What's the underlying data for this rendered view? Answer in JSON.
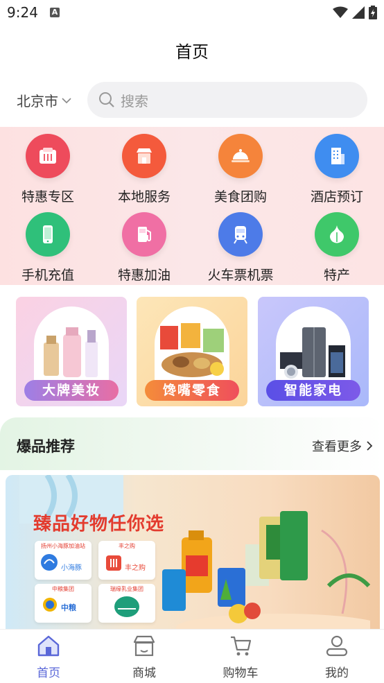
{
  "status_bar": {
    "time": "9:24",
    "notification_badge": "A"
  },
  "header": {
    "title": "首页"
  },
  "location": {
    "city": "北京市"
  },
  "search": {
    "placeholder": "搜索"
  },
  "categories": [
    {
      "label": "特惠专区",
      "icon": "ticket-icon",
      "color": "#ee4b5c"
    },
    {
      "label": "本地服务",
      "icon": "shop-icon",
      "color": "#f45a3c"
    },
    {
      "label": "美食团购",
      "icon": "dish-cover-icon",
      "color": "#f5843b"
    },
    {
      "label": "酒店预订",
      "icon": "building-icon",
      "color": "#3f8df0"
    },
    {
      "label": "手机充值",
      "icon": "phone-icon",
      "color": "#2fc07a"
    },
    {
      "label": "特惠加油",
      "icon": "fuel-icon",
      "color": "#f06fa4"
    },
    {
      "label": "火车票机票",
      "icon": "train-icon",
      "color": "#4d7be8"
    },
    {
      "label": "特产",
      "icon": "garlic-icon",
      "color": "#3fc86a"
    }
  ],
  "promos": [
    {
      "label": "大牌美妆",
      "icon": "cosmetics-icon"
    },
    {
      "label": "馋嘴零食",
      "icon": "snacks-icon"
    },
    {
      "label": "智能家电",
      "icon": "appliances-icon"
    }
  ],
  "hot": {
    "title": "爆品推荐",
    "more": "查看更多"
  },
  "banner": {
    "title": "臻品好物任你选",
    "brands": [
      {
        "label": "扬州小海豚加油站",
        "name": "小海豚"
      },
      {
        "label": "丰之购",
        "name": "丰之购"
      },
      {
        "label": "中粮集团",
        "name": "中粮"
      },
      {
        "label": "瑞缘乳业集团",
        "name": ""
      }
    ]
  },
  "tabs": [
    {
      "label": "首页",
      "icon": "home-icon",
      "active": true
    },
    {
      "label": "商城",
      "icon": "store-icon",
      "active": false
    },
    {
      "label": "购物车",
      "icon": "cart-icon",
      "active": false
    },
    {
      "label": "我的",
      "icon": "user-icon",
      "active": false
    }
  ],
  "colors": {
    "accent": "#5a67d8",
    "banner_title": "#e33b2e"
  }
}
